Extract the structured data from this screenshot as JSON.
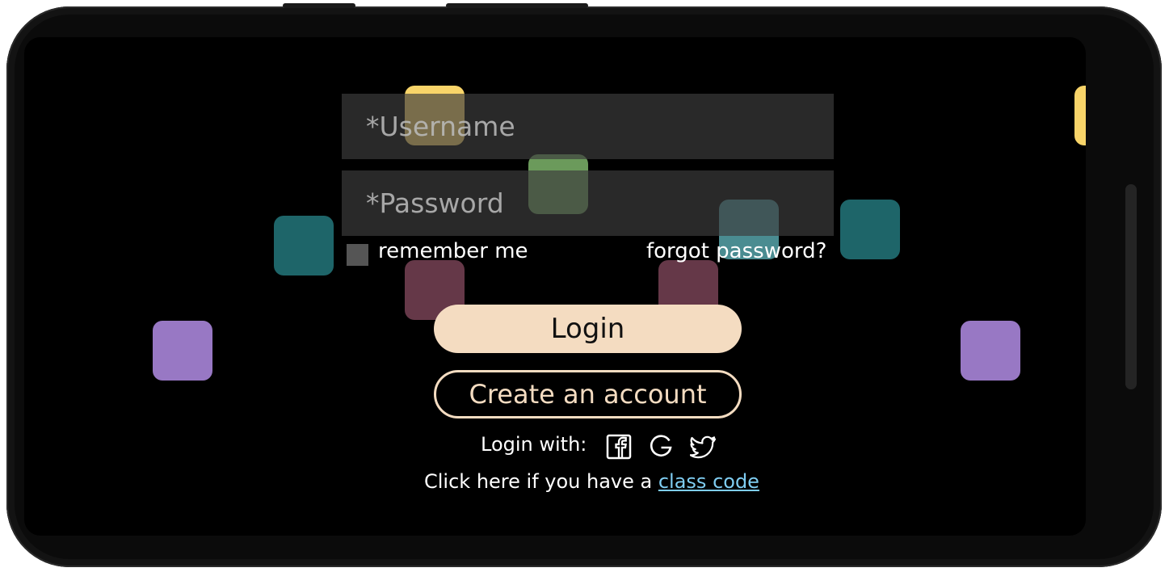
{
  "form": {
    "username_placeholder": "*Username",
    "password_placeholder": "*Password",
    "remember_label": "remember me",
    "forgot_label": "forgot password?"
  },
  "buttons": {
    "login_label": "Login",
    "create_label": "Create an account"
  },
  "social": {
    "login_with_label": "Login with:",
    "icons": [
      "facebook-icon",
      "google-icon",
      "twitter-icon"
    ]
  },
  "class_code": {
    "prefix": "Click here if you have a ",
    "link_label": "class code"
  },
  "colors": {
    "screen_background": "#000000",
    "input_background": "#3c3c3c",
    "login_button": "#f4dcc1",
    "link": "#7fcdf2",
    "tile_yellow": "#f8d469",
    "tile_green": "#6b9a5b",
    "tile_teal": "#1e6569",
    "tile_teal_light": "#4a8c91",
    "tile_maroon": "#653848",
    "tile_purple": "#9878c4"
  }
}
